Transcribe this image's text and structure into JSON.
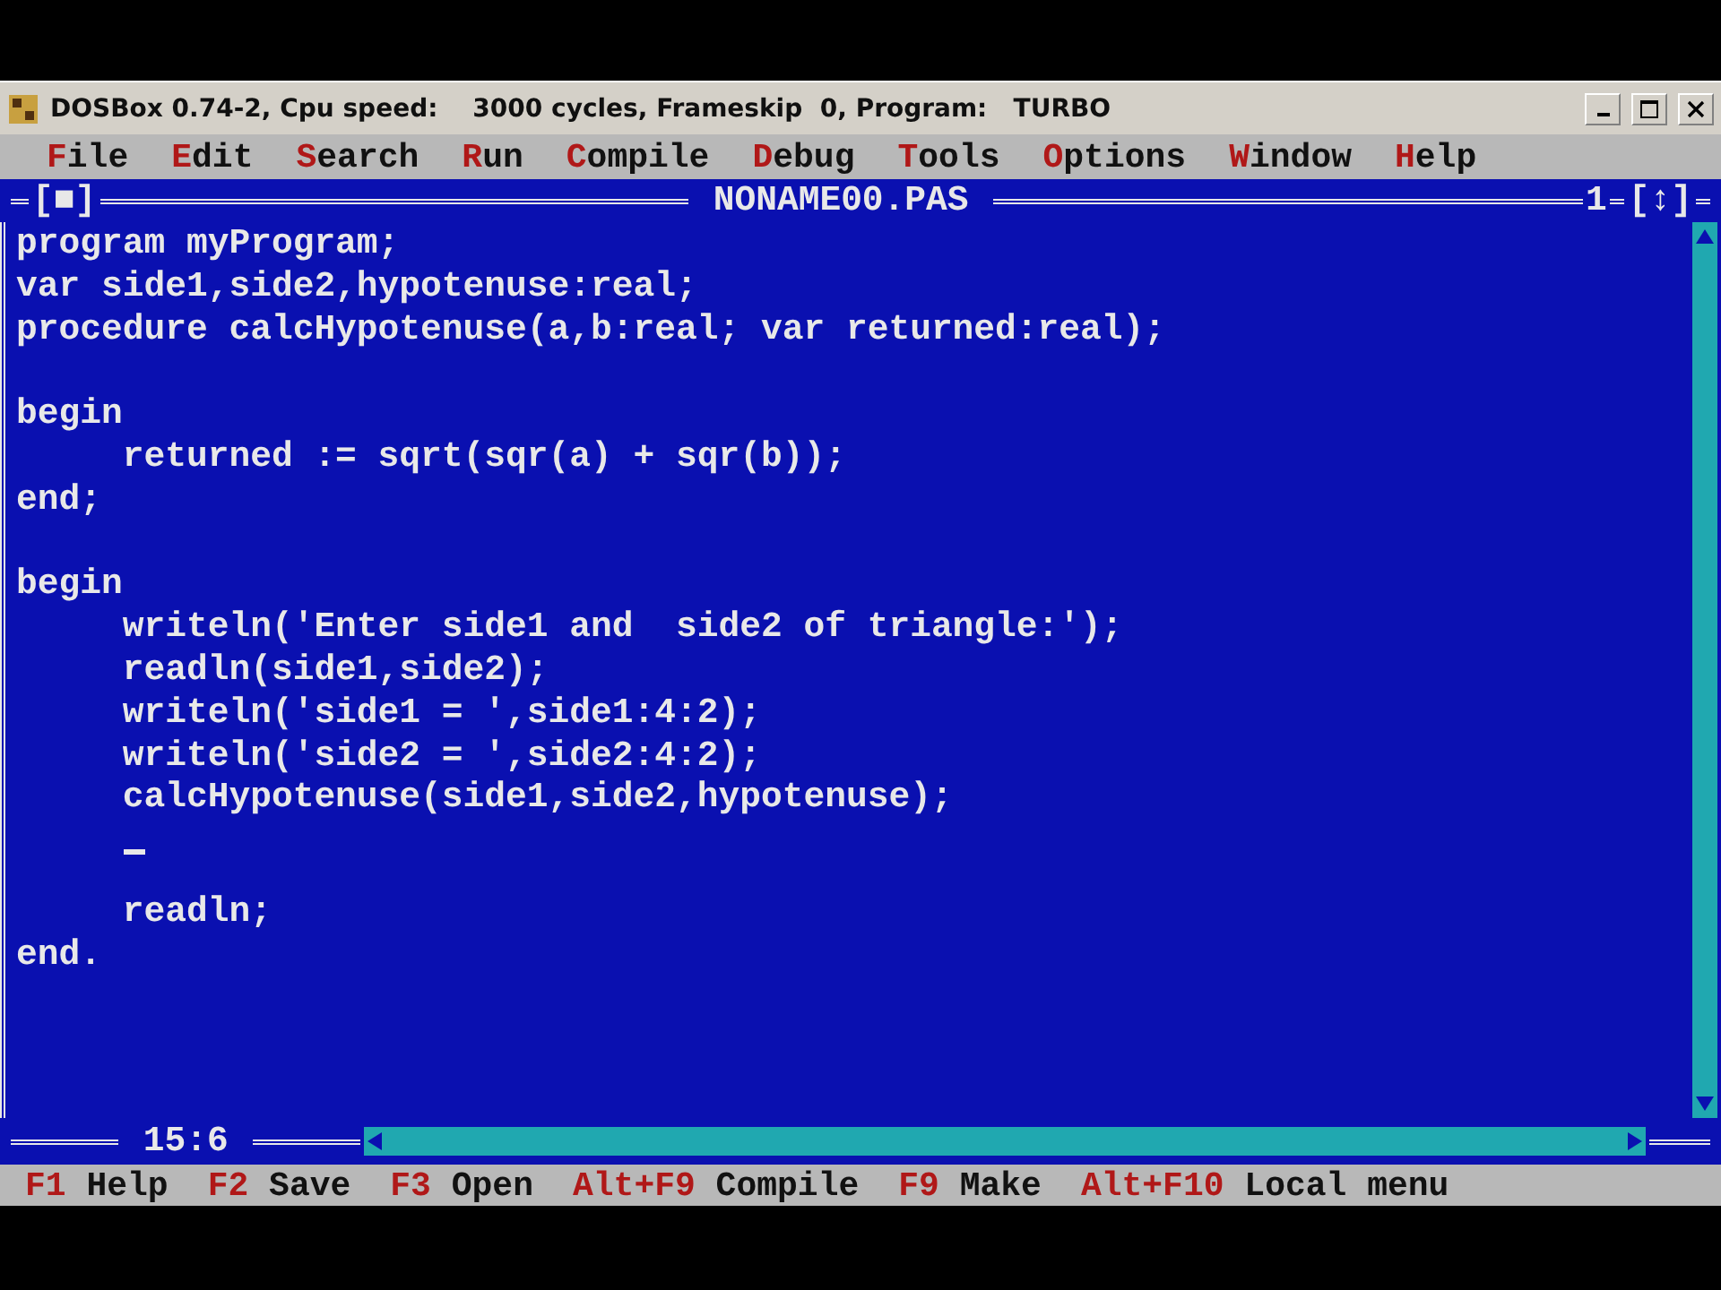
{
  "window": {
    "title": "DOSBox 0.74-2, Cpu speed:    3000 cycles, Frameskip  0, Program:   TURBO"
  },
  "menu": [
    {
      "label": "File"
    },
    {
      "label": "Edit"
    },
    {
      "label": "Search"
    },
    {
      "label": "Run"
    },
    {
      "label": "Compile"
    },
    {
      "label": "Debug"
    },
    {
      "label": "Tools"
    },
    {
      "label": "Options"
    },
    {
      "label": "Window"
    },
    {
      "label": "Help"
    }
  ],
  "editor": {
    "close_box": "[■]",
    "title": "NONAME00.PAS",
    "window_number": "1",
    "zoom_box": "[↕]",
    "position": "15:6",
    "lines": [
      {
        "kind": "code",
        "text": "program myProgram;"
      },
      {
        "kind": "code",
        "text": "var side1,side2,hypotenuse:real;"
      },
      {
        "kind": "code",
        "text": "procedure calcHypotenuse(a,b:real; var returned:real);"
      },
      {
        "kind": "blank"
      },
      {
        "kind": "code",
        "text": "begin"
      },
      {
        "kind": "code",
        "text": "     returned := sqrt(sqr(a) + sqr(b));"
      },
      {
        "kind": "code",
        "text": "end;"
      },
      {
        "kind": "blank"
      },
      {
        "kind": "code",
        "text": "begin"
      },
      {
        "kind": "code",
        "text": "     writeln('Enter side1 and  side2 of triangle:');"
      },
      {
        "kind": "code",
        "text": "     readln(side1,side2);"
      },
      {
        "kind": "code",
        "text": "     writeln('side1 = ',side1:4:2);"
      },
      {
        "kind": "code",
        "text": "     writeln('side2 = ',side2:4:2);"
      },
      {
        "kind": "code",
        "text": "     calcHypotenuse(side1,side2,hypotenuse);"
      },
      {
        "kind": "cursor"
      },
      {
        "kind": "code",
        "text": "     readln;"
      },
      {
        "kind": "code",
        "text": "end."
      }
    ]
  },
  "status_bar": [
    {
      "key": "F1",
      "label": "Help"
    },
    {
      "key": "F2",
      "label": "Save"
    },
    {
      "key": "F3",
      "label": "Open"
    },
    {
      "key": "Alt+F9",
      "label": "Compile"
    },
    {
      "key": "F9",
      "label": "Make"
    },
    {
      "key": "Alt+F10",
      "label": "Local menu"
    }
  ]
}
